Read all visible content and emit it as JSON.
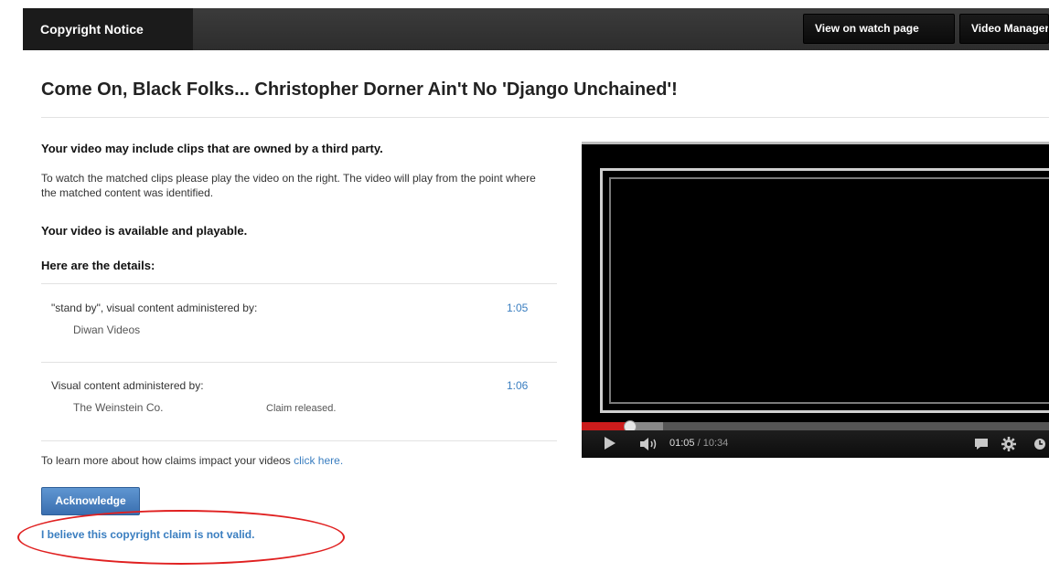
{
  "topbar": {
    "tab_label": "Copyright Notice",
    "watch_button": "View on watch page",
    "manager_button": "Video Manager"
  },
  "page": {
    "title": "Come On, Black Folks... Christopher Dorner Ain't No 'Django Unchained'!"
  },
  "notice": {
    "heading": "Your video may include clips that are owned by a third party.",
    "description": "To watch the matched clips please play the video on the right. The video will play from the point where the matched content was identified.",
    "status": "Your video is available and playable.",
    "details_heading": "Here are the details:"
  },
  "claims": [
    {
      "title": "\"stand by\", visual content administered by:",
      "owner": "Diwan Videos",
      "time": "1:05",
      "note": ""
    },
    {
      "title": "Visual content administered by:",
      "owner": "The Weinstein Co.",
      "time": "1:06",
      "note": "Claim released."
    }
  ],
  "learn_more": {
    "text": "To learn more about how claims impact your videos",
    "link": "click here."
  },
  "actions": {
    "acknowledge": "Acknowledge",
    "dispute": "I believe this copyright claim is not valid."
  },
  "player": {
    "current_time": "01:05",
    "duration": "/ 10:34",
    "progress_fraction": 0.103,
    "icons": [
      "play-icon",
      "volume-icon",
      "captions-icon",
      "gear-icon",
      "clock-icon"
    ]
  },
  "colors": {
    "link": "#3a7ec0",
    "accent_red": "#cc1c1c",
    "annotation": "#e02020"
  }
}
